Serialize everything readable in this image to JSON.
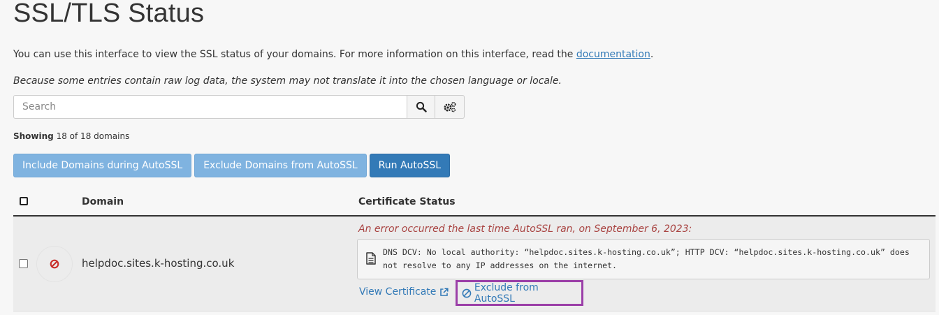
{
  "page": {
    "title": "SSL/TLS Status",
    "intro_text": "You can use this interface to view the SSL status of your domains. For more information on this interface, read the ",
    "intro_link": "documentation",
    "intro_end": ".",
    "note": "Because some entries contain raw log data, the system may not translate it into the chosen language or locale."
  },
  "search": {
    "placeholder": "Search",
    "search_icon": "search-icon",
    "settings_icon": "cogs-icon"
  },
  "summary": {
    "label": "Showing",
    "text": "18 of 18 domains"
  },
  "actions": {
    "include": "Include Domains during AutoSSL",
    "exclude": "Exclude Domains from AutoSSL",
    "run": "Run AutoSSL"
  },
  "table": {
    "headers": {
      "domain": "Domain",
      "status": "Certificate Status"
    },
    "rows": [
      {
        "domain": "helpdoc.sites.k-hosting.co.uk",
        "status_icon": "ban-icon",
        "error": "An error occurred the last time AutoSSL ran, on September 6, 2023:",
        "log": "DNS DCV: No local authority: “helpdoc.sites.k-hosting.co.uk”; HTTP DCV: “helpdoc.sites.k-hosting.co.uk” does not resolve to any IP addresses on the internet.",
        "view_certificate": "View Certificate",
        "exclude": "Exclude from AutoSSL"
      }
    ]
  },
  "colors": {
    "primary": "#337ab7",
    "primary_light": "#7fb3e0",
    "error": "#a94442",
    "highlight": "#9b3fa8"
  }
}
